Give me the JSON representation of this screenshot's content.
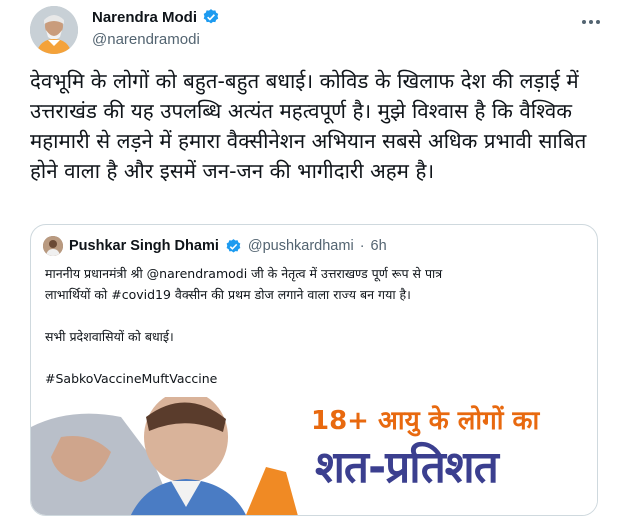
{
  "author": {
    "name": "Narendra Modi",
    "handle": "@narendramodi",
    "avatar_icon": "profile-photo",
    "verified_icon": "verified-badge-icon"
  },
  "tweet": {
    "text": "देवभूमि के लोगों को बहुत-बहुत बधाई। कोविड के खिलाफ देश की लड़ाई में उत्तराखंड की यह उपलब्धि अत्यंत महत्वपूर्ण है। मुझे विश्वास है कि वैश्विक महामारी से लड़ने में हमारा वैक्सीनेशन अभियान सबसे अधिक प्रभावी साबित होने वाला है और इसमें जन-जन की भागीदारी अहम है।"
  },
  "quoted": {
    "name": "Pushkar Singh Dhami",
    "handle": "@pushkardhami",
    "separator": "·",
    "time": "6h",
    "line1": "माननीय प्रधानमंत्री श्री @narendramodi जी के नेतृत्व में उत्तराखण्ड पूर्ण रूप से पात्र",
    "line2": "लाभार्थियों को #covid19 वैक्सीन की प्रथम डोज लगाने वाला राज्य बन गया है।",
    "line3": "सभी प्रदेशवासियों को बधाई।",
    "hashtag": "#SabkoVaccineMuftVaccine",
    "banner_line1": "18+ आयु के लोगों का",
    "banner_line2": "शत-प्रतिशत"
  },
  "colors": {
    "verified": "#1d9bf0",
    "banner_orange": "#e8690f",
    "banner_blue": "#3b3f8f"
  }
}
